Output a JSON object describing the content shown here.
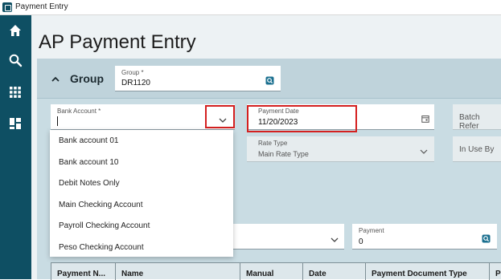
{
  "window": {
    "title": "Payment Entry"
  },
  "nav": {
    "icons": [
      "home-icon",
      "search-icon",
      "apps-grid-icon",
      "dashboard-icon"
    ]
  },
  "page": {
    "title": "AP Payment Entry"
  },
  "group": {
    "label": "Group",
    "field_label": "Group *",
    "field_value": "DR1120"
  },
  "bank_account": {
    "label": "Bank Account *",
    "value": ""
  },
  "payment_date": {
    "label": "Payment Date",
    "value": "11/20/2023"
  },
  "batch_ref": {
    "label": "Batch Refer"
  },
  "rate_type": {
    "label": "Rate Type",
    "value": "Main Rate Type"
  },
  "in_use_by": {
    "label": "In Use By"
  },
  "payment": {
    "label": "Payment",
    "value": "0"
  },
  "bank_dropdown": {
    "options": [
      "Bank account 01",
      "Bank account 10",
      "Debit Notes Only",
      "Main Checking Account",
      "Payroll Checking Account",
      "Peso Checking Account"
    ]
  },
  "grid": {
    "columns": [
      "Payment N...",
      "Name",
      "Manual",
      "Date",
      "Payment Document Type",
      "P"
    ]
  },
  "colors": {
    "nav": "#0e4f63",
    "panel": "#c9dce3",
    "highlight": "#d42020",
    "accent": "#1a6f8f"
  }
}
